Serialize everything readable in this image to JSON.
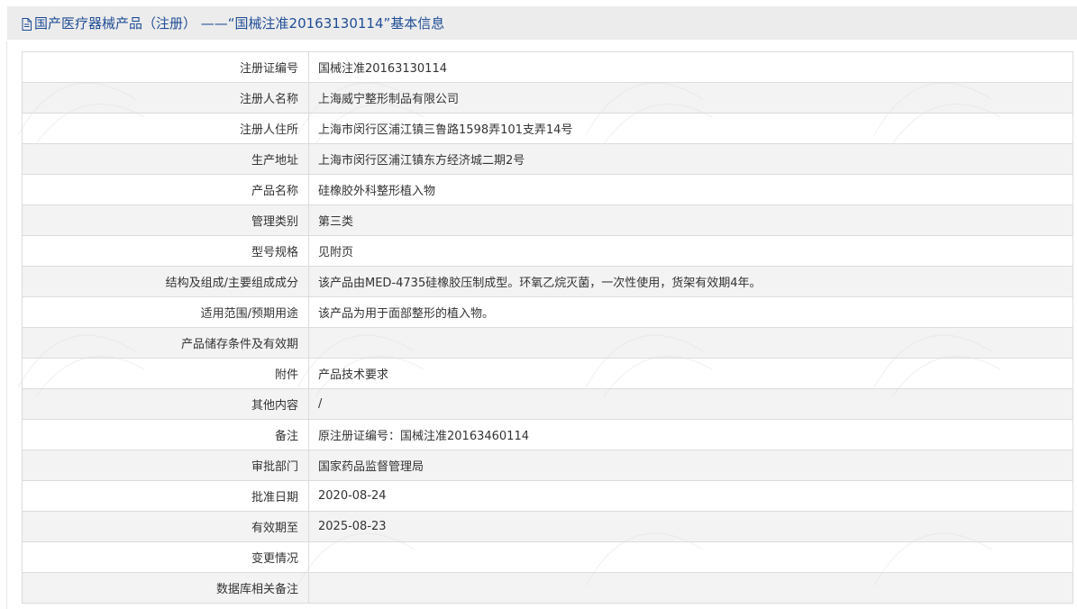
{
  "header": {
    "icon": "document-icon",
    "title": "国产医疗器械产品（注册） ——“国械注准20163130114”基本信息"
  },
  "rows": [
    {
      "label": "注册证编号",
      "value": "国械注准20163130114"
    },
    {
      "label": "注册人名称",
      "value": "上海威宁整形制品有限公司"
    },
    {
      "label": "注册人住所",
      "value": "上海市闵行区浦江镇三鲁路1598弄101支弄14号"
    },
    {
      "label": "生产地址",
      "value": "上海市闵行区浦江镇东方经济城二期2号"
    },
    {
      "label": "产品名称",
      "value": "硅橡胶外科整形植入物"
    },
    {
      "label": "管理类别",
      "value": "第三类"
    },
    {
      "label": "型号规格",
      "value": "见附页"
    },
    {
      "label": "结构及组成/主要组成成分",
      "value": "该产品由MED-4735硅橡胶压制成型。环氧乙烷灭菌，一次性使用，货架有效期4年。"
    },
    {
      "label": "适用范围/预期用途",
      "value": "该产品为用于面部整形的植入物。"
    },
    {
      "label": "产品储存条件及有效期",
      "value": ""
    },
    {
      "label": "附件",
      "value": "产品技术要求"
    },
    {
      "label": "其他内容",
      "value": "/"
    },
    {
      "label": "备注",
      "value": "原注册证编号：国械注准20163460114"
    },
    {
      "label": "审批部门",
      "value": "国家药品监督管理局"
    },
    {
      "label": "批准日期",
      "value": "2020-08-24"
    },
    {
      "label": "有效期至",
      "value": "2025-08-23"
    },
    {
      "label": "变更情况",
      "value": ""
    },
    {
      "label": "数据库相关备注",
      "value": ""
    }
  ],
  "colors": {
    "header_bg": "#ececec",
    "title": "#1f4d96",
    "border": "#dcdcdc",
    "row_alt": "#f3f3f3"
  }
}
